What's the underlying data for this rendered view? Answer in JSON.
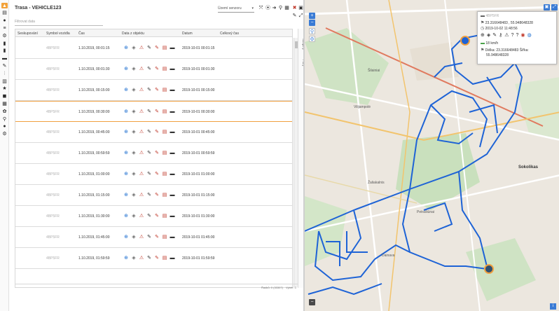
{
  "rail": {
    "icons": [
      "warning-icon",
      "table-icon",
      "info-icon",
      "list-icon",
      "route-icon",
      "car-icon",
      "clipboard-icon",
      "bars-icon",
      "wrench-icon",
      "sliders-icon",
      "chart-icon",
      "star-icon",
      "chat-icon",
      "calendar-icon",
      "settings-icon",
      "key-icon",
      "user-icon",
      "gear-icon"
    ],
    "glyphs": [
      "▲",
      "▤",
      "●",
      "≡",
      "⚙",
      "▮",
      "▮",
      "▬",
      "✎",
      "⫶",
      "▥",
      "★",
      "◼",
      "▦",
      "✿",
      "⚲",
      "●",
      "⚙"
    ]
  },
  "panel": {
    "title": "Trasa - VEHICLE123",
    "sensor_placeholder": "Území senzoru",
    "filter_placeholder": "Filtrovat data",
    "toolbar_glyphs": [
      "⤧",
      "⦿",
      "➜",
      "⚲",
      "▦",
      "✖",
      "▣"
    ]
  },
  "grid": {
    "columns": [
      "Seskupování",
      "Symbol vozidla",
      "Čas",
      "Data z objektu",
      "Datum",
      "Celkový čas"
    ],
    "rows": [
      {
        "plate": "4BP5FR",
        "time": "1.10.2019, 00:01:15",
        "date": "2019-10-01 00:01:15"
      },
      {
        "plate": "4BP5FR",
        "time": "1.10.2019, 00:01:30",
        "date": "2019-10-01 00:01:30"
      },
      {
        "plate": "4BP5FR",
        "time": "1.10.2019, 00:15:00",
        "date": "2019-10-01 00:15:00"
      },
      {
        "plate": "4BP5FR",
        "time": "1.10.2019, 00:30:00",
        "date": "2019-10-01 00:30:00"
      },
      {
        "plate": "4BP5FR",
        "time": "1.10.2019, 00:45:00",
        "date": "2019-10-01 00:45:00"
      },
      {
        "plate": "4BP5FR",
        "time": "1.10.2019, 00:59:59",
        "date": "2019-10-01 00:59:59"
      },
      {
        "plate": "4BP5FR",
        "time": "1.10.2019, 01:00:00",
        "date": "2019-10-01 01:00:00"
      },
      {
        "plate": "4BP5FR",
        "time": "1.10.2019, 01:15:00",
        "date": "2019-10-01 01:15:00"
      },
      {
        "plate": "4BP5FR",
        "time": "1.10.2019, 01:30:00",
        "date": "2019-10-01 01:30:00"
      },
      {
        "plate": "4BP5FR",
        "time": "1.10.2019, 01:45:00",
        "date": "2019-10-01 01:45:00"
      },
      {
        "plate": "4BP5FR",
        "time": "1.10.2019, 01:59:59",
        "date": "2019-10-01 01:59:59"
      }
    ],
    "row_icons": [
      "plus-circle-icon",
      "sensor-icon",
      "fuel-icon",
      "plug-icon",
      "unplug-icon",
      "alert-doc-icon",
      "truck-icon"
    ],
    "row_glyphs": [
      "⊕",
      "◈",
      "⚠",
      "✎",
      "✎",
      "▤",
      "▬"
    ],
    "row_icon_colors": [
      "#1e6fd0",
      "#666666",
      "#c0392b",
      "#333333",
      "#c0392b",
      "#c0392b",
      "#333333"
    ],
    "vertical_tabs": [
      "Skupiny",
      "Filtry"
    ],
    "footer_left": "Řádků: 0 (33307)",
    "footer_right": "Výběr: 0"
  },
  "map": {
    "popup": {
      "plate": "4BP5FR",
      "coords": "23.316648483 , 55.948648328",
      "datetime": "2019-10-02 11:48:56",
      "speed": "18 km/h",
      "delka": "Délka: 23.316648483 Šířka:",
      "sirka": "55.948648328"
    },
    "labels": [
      "Sokolikas",
      "Žaliakalnis",
      "Petrašiūnai",
      "Šilainiai",
      "Vilijampolė",
      "Dainava"
    ],
    "zoom_in": "+",
    "zoom_out": "−",
    "info": "i",
    "route_color": "#1e63d6"
  }
}
